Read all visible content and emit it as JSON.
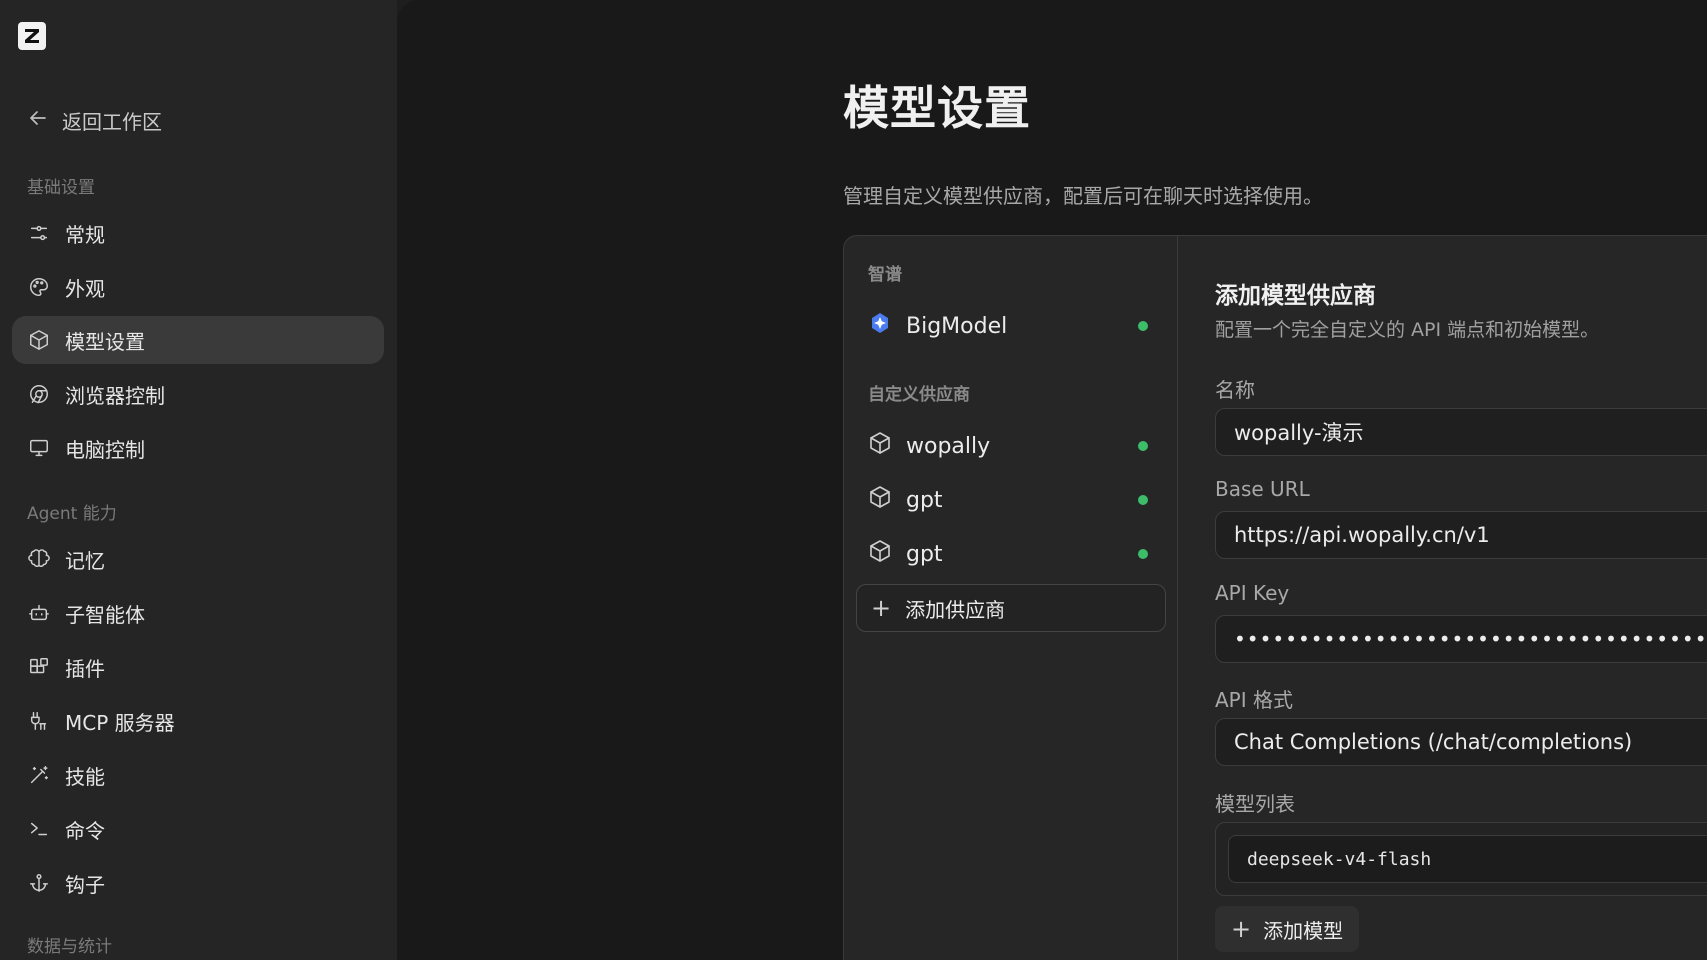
{
  "sidebar": {
    "back_label": "返回工作区",
    "sections": [
      {
        "label": "基础设置"
      },
      {
        "label": "Agent 能力"
      },
      {
        "label": "数据与统计"
      }
    ],
    "items": [
      {
        "label": "常规",
        "icon": "sliders-icon"
      },
      {
        "label": "外观",
        "icon": "palette-icon"
      },
      {
        "label": "模型设置",
        "icon": "cube-icon",
        "active": true
      },
      {
        "label": "浏览器控制",
        "icon": "chrome-icon"
      },
      {
        "label": "电脑控制",
        "icon": "monitor-icon"
      },
      {
        "label": "记忆",
        "icon": "brain-icon"
      },
      {
        "label": "子智能体",
        "icon": "bot-icon"
      },
      {
        "label": "插件",
        "icon": "blocks-icon"
      },
      {
        "label": "MCP 服务器",
        "icon": "plug-icon"
      },
      {
        "label": "技能",
        "icon": "wand-icon"
      },
      {
        "label": "命令",
        "icon": "terminal-icon"
      },
      {
        "label": "钩子",
        "icon": "anchor-icon"
      }
    ]
  },
  "main": {
    "title": "模型设置",
    "description": "管理自定义模型供应商，配置后可在聊天时选择使用。"
  },
  "providers": {
    "group_zhipu": "智谱",
    "group_custom": "自定义供应商",
    "zhipu_items": [
      {
        "name": "BigModel",
        "status": "active"
      }
    ],
    "custom_items": [
      {
        "name": "wopally",
        "status": "active"
      },
      {
        "name": "gpt",
        "status": "active"
      },
      {
        "name": "gpt",
        "status": "active"
      }
    ],
    "add_label": "添加供应商"
  },
  "form": {
    "title": "添加模型供应商",
    "description": "配置一个完全自定义的 API 端点和初始模型。",
    "name_label": "名称",
    "name_value": "wopally-演示",
    "base_url_label": "Base URL",
    "base_url_value": "https://api.wopally.cn/v1",
    "api_key_label": "API Key",
    "api_key_value": "••••••••••••••••••••••••••••••••••••••••••••••••••••••••••••••••",
    "api_format_label": "API 格式",
    "api_format_value": "Chat Completions (/chat/completions)",
    "models_label": "模型列表",
    "models": [
      "deepseek-v4-flash"
    ],
    "add_model_label": "添加模型"
  },
  "colors": {
    "status_green": "#3dbd6a",
    "active_bg": "#3a3a3a"
  }
}
